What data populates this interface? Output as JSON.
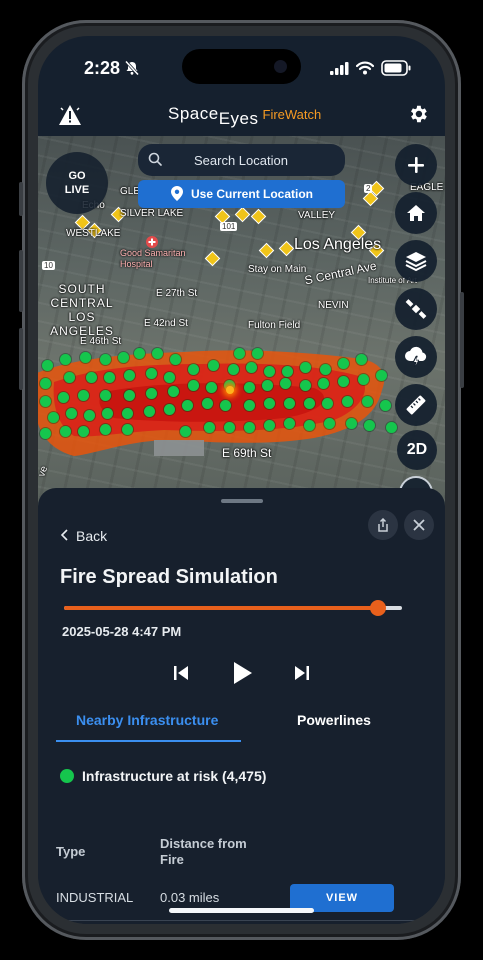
{
  "status_bar": {
    "time": "2:28",
    "icons": [
      "bell-slash-icon",
      "signal-icon",
      "wifi-icon",
      "battery-icon"
    ]
  },
  "header": {
    "brand_part1": "Space",
    "brand_part2": "Eyes",
    "brand_part3": "FireWatch",
    "left_icon": "alert-triangle-icon",
    "right_icon": "gear-icon"
  },
  "map": {
    "go_live_line1": "GO",
    "go_live_line2": "LIVE",
    "search_placeholder": "Search Location",
    "use_location_label": "Use Current Location",
    "controls": [
      "plus-icon",
      "home-icon",
      "layers-icon",
      "satellite-icon",
      "cloud-lightning-icon",
      "ruler-icon"
    ],
    "mode_label": "2D",
    "labels": {
      "glendale_partial": "GLE",
      "silver_lake": "SILVER LAKE",
      "echo_partial": "Echo",
      "westlake": "WESTLAKE",
      "valley_partial": "VALLEY",
      "eagle_rock_partial": "EAGLE R",
      "hospital": "Good Samaritan Hospital",
      "stay_on_main": "Stay on Main",
      "los_angeles": "Los Angeles",
      "s_central_ave": "S Central Ave",
      "institute_partial": "Institute of Art",
      "south_central": "SOUTH CENTRAL LOS ANGELES",
      "e27": "E 27th St",
      "e42": "E 42nd St",
      "fulton": "Fulton Field",
      "nevin": "NEVIN",
      "e46": "E 46th St",
      "e69": "E 69th St",
      "hwy10": "10",
      "hwy101": "101",
      "hwy2": "2",
      "ave_partial": "ve"
    }
  },
  "sheet": {
    "back_label": "Back",
    "title": "Fire Spread Simulation",
    "timeline_progress": 0.93,
    "datetime": "2025-05-28 4:47 PM",
    "tabs": [
      "Nearby Infrastructure",
      "Powerlines"
    ],
    "risk_label": "Infrastructure at risk (4,475)",
    "table": {
      "headers": [
        "Type",
        "Distance from Fire"
      ],
      "header_line1": "Distance from",
      "header_line2": "Fire",
      "rows": [
        {
          "type": "INDUSTRIAL",
          "distance": "0.03 miles",
          "action": "VIEW"
        }
      ]
    }
  },
  "colors": {
    "accent": "#1f6fd1",
    "fire": "#e8601c",
    "at_risk": "#15c64d",
    "brand_orange": "#f59a23"
  }
}
